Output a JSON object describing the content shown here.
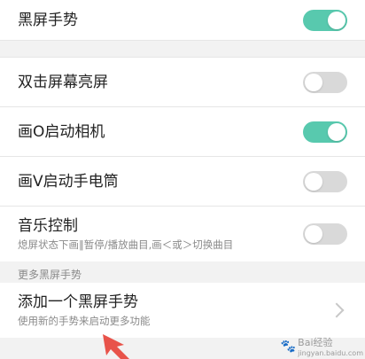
{
  "top_setting": {
    "label": "黑屏手势",
    "enabled": true
  },
  "gesture_settings": [
    {
      "label": "双击屏幕亮屏",
      "enabled": false
    },
    {
      "label": "画O启动相机",
      "enabled": true
    },
    {
      "label": "画V启动手电筒",
      "enabled": false
    },
    {
      "label": "音乐控制",
      "subtitle": "熄屏状态下画‖暂停/播放曲目,画＜或＞切换曲目",
      "enabled": false
    }
  ],
  "more_section": {
    "label": "更多黑屏手势",
    "add_item": {
      "label": "添加一个黑屏手势",
      "subtitle": "使用新的手势来启动更多功能"
    }
  },
  "watermark": {
    "text": "Bai经验",
    "url": "jingyan.baidu.com"
  },
  "colors": {
    "toggle_on": "#58c9ae",
    "toggle_off": "#d9d9d9",
    "annotation_arrow": "#e8534a"
  }
}
